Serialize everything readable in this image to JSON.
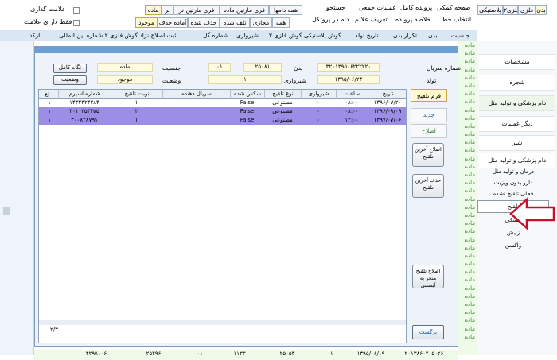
{
  "toolbar": {
    "tabs": [
      "بدن",
      "فلزی",
      "فلزی۲",
      "پلاستیکی"
    ],
    "row1": [
      "صفحه کمکی",
      "پرونده کامل",
      "عملیات جمعی",
      "جستجو"
    ],
    "row2": [
      "انتخاب خط",
      "خلاصه پرونده",
      "تعریف علائم",
      "دام در پروتکل"
    ],
    "filter_row1": [
      "همه دامها",
      "فری مارتین ماده",
      "فری مارتین نر",
      "نر",
      "ماده"
    ],
    "filter_row2": [
      "همه",
      "مجازی",
      "تلف شده",
      "حذف شده",
      "آماده حذف",
      "موجود"
    ],
    "checkbox_mark": "علامت گذاری",
    "checkbox_marked_only": "فقط دارای علامت"
  },
  "column_header": [
    "جنسیت",
    "بدن",
    "تکرار بدن",
    "تاریخ تولد",
    "۲ گوش پلاستیکی گوش فلزی",
    "شیرواری",
    "شماره گل",
    "ثبت اصلاح نژاد گوش فلزی ۲ شماره بین المللی",
    "بارکد"
  ],
  "right_column_words": [
    "ماده",
    "ماده",
    "ماده",
    "ماده",
    "ماده",
    "ماده",
    "ماده",
    "ماده",
    "ماده",
    "ماده",
    "ماده",
    "ماده",
    "ماده",
    "ماده",
    "ماده",
    "ماده",
    "ماده",
    "ماده",
    "ماده",
    "ماده",
    "ماده",
    "ماده",
    "ماده",
    "ماده",
    "ماده",
    "ماده",
    "ماده",
    "ماده",
    "ماده",
    "ماده",
    "ماده",
    "ماده",
    "ماده",
    "ماده",
    "ماده",
    "ماده",
    "ماده"
  ],
  "dialog": {
    "labels": {
      "serial": "شماره سریال",
      "body": "بدن",
      "gender": "جنسیت",
      "milking": "شیرواری",
      "birth": "تولد",
      "status": "وضعیت"
    },
    "values": {
      "serial": "۳۲۰۱۳۹۵۰۶۲۲۲۲۲۰",
      "body": "۲۵۰۸۱",
      "body_code": "۰۱",
      "gender": "ماده",
      "milking": "۱",
      "birth": "۱۳۹۵/۰۶/۲۴",
      "status": "موجود"
    },
    "buttons": {
      "keep_complete": "نگاه کامل",
      "status": "وضعیت"
    },
    "grid": {
      "columns": [
        "تاریخ",
        "ساعت",
        "شیرواری",
        "نوع تلقیح",
        "سکس شده",
        "سریال دهنده",
        "نوبت تلقیح",
        "شماره اسپرم",
        "تع..."
      ],
      "rows": [
        {
          "date": "۱۳۹۶/۰۷/۲۰",
          "time": "۰۸:۰۰",
          "milking": "۰",
          "type": "مصنوعی",
          "sexed": "False",
          "donor": "",
          "round": "۱",
          "sperm": "۱۴۳۲۳۲۴۲۸۴",
          "count": "۱"
        },
        {
          "date": "۱۳۹۶/۰۸/۰۹",
          "time": "۰۸:۰۰",
          "milking": "۰",
          "type": "مصنوعی",
          "sexed": "False",
          "donor": "",
          "round": "۲",
          "sperm": "۳۰۱۰۳۵۳۲۵۵",
          "count": "۱"
        },
        {
          "date": "۱۳۹۷/۰۷/۰۶",
          "time": "۱۴:۰۰",
          "milking": "۰",
          "type": "مصنوعی",
          "sexed": "False",
          "donor": "",
          "round": "۱",
          "sperm": "۳۰۰۸۲۸۷۹۱",
          "count": "۱"
        }
      ],
      "pager": "۲/۳"
    },
    "side_tabs": [
      "فرم تلقیح",
      "جدید",
      "اصلاح"
    ],
    "side_buttons": [
      "اصلاح آخرین تلقیح",
      "حذف آخرین تلقیح",
      "اصلاح تلقیح منجر به آبستنی"
    ],
    "return_button": "برگشت"
  },
  "menu": {
    "items": [
      "مشخصات",
      "شجره",
      "دام پزشکی و تولید مثل",
      "دیگر عملیات",
      "شیر",
      "دام پزشکی و تولید مثل"
    ],
    "sub_items": [
      "درمان و تولید مثل",
      "دارو بدون ویزیت",
      "فحلی تلقیح نشده",
      "تلقیح",
      "خشکی",
      "زایش",
      "واکسن"
    ]
  },
  "footer_rows": [
    [
      "۲۰۱۳۸۶۰۲۰۵۰۲۶",
      "۱۳۹۵/۰۶/۱۹",
      "۰۱",
      "۲۵۰۵۳",
      "۱۱۳۳",
      "۰۱",
      "۲۵۲۹۶",
      "۴۲۹۸۱۰۶"
    ]
  ],
  "colors": {
    "selected_row": "#9c8ee6",
    "title_bar": "#6aa0d6",
    "arrow": "#c8102e",
    "accent_green": "#3b8a2e"
  }
}
